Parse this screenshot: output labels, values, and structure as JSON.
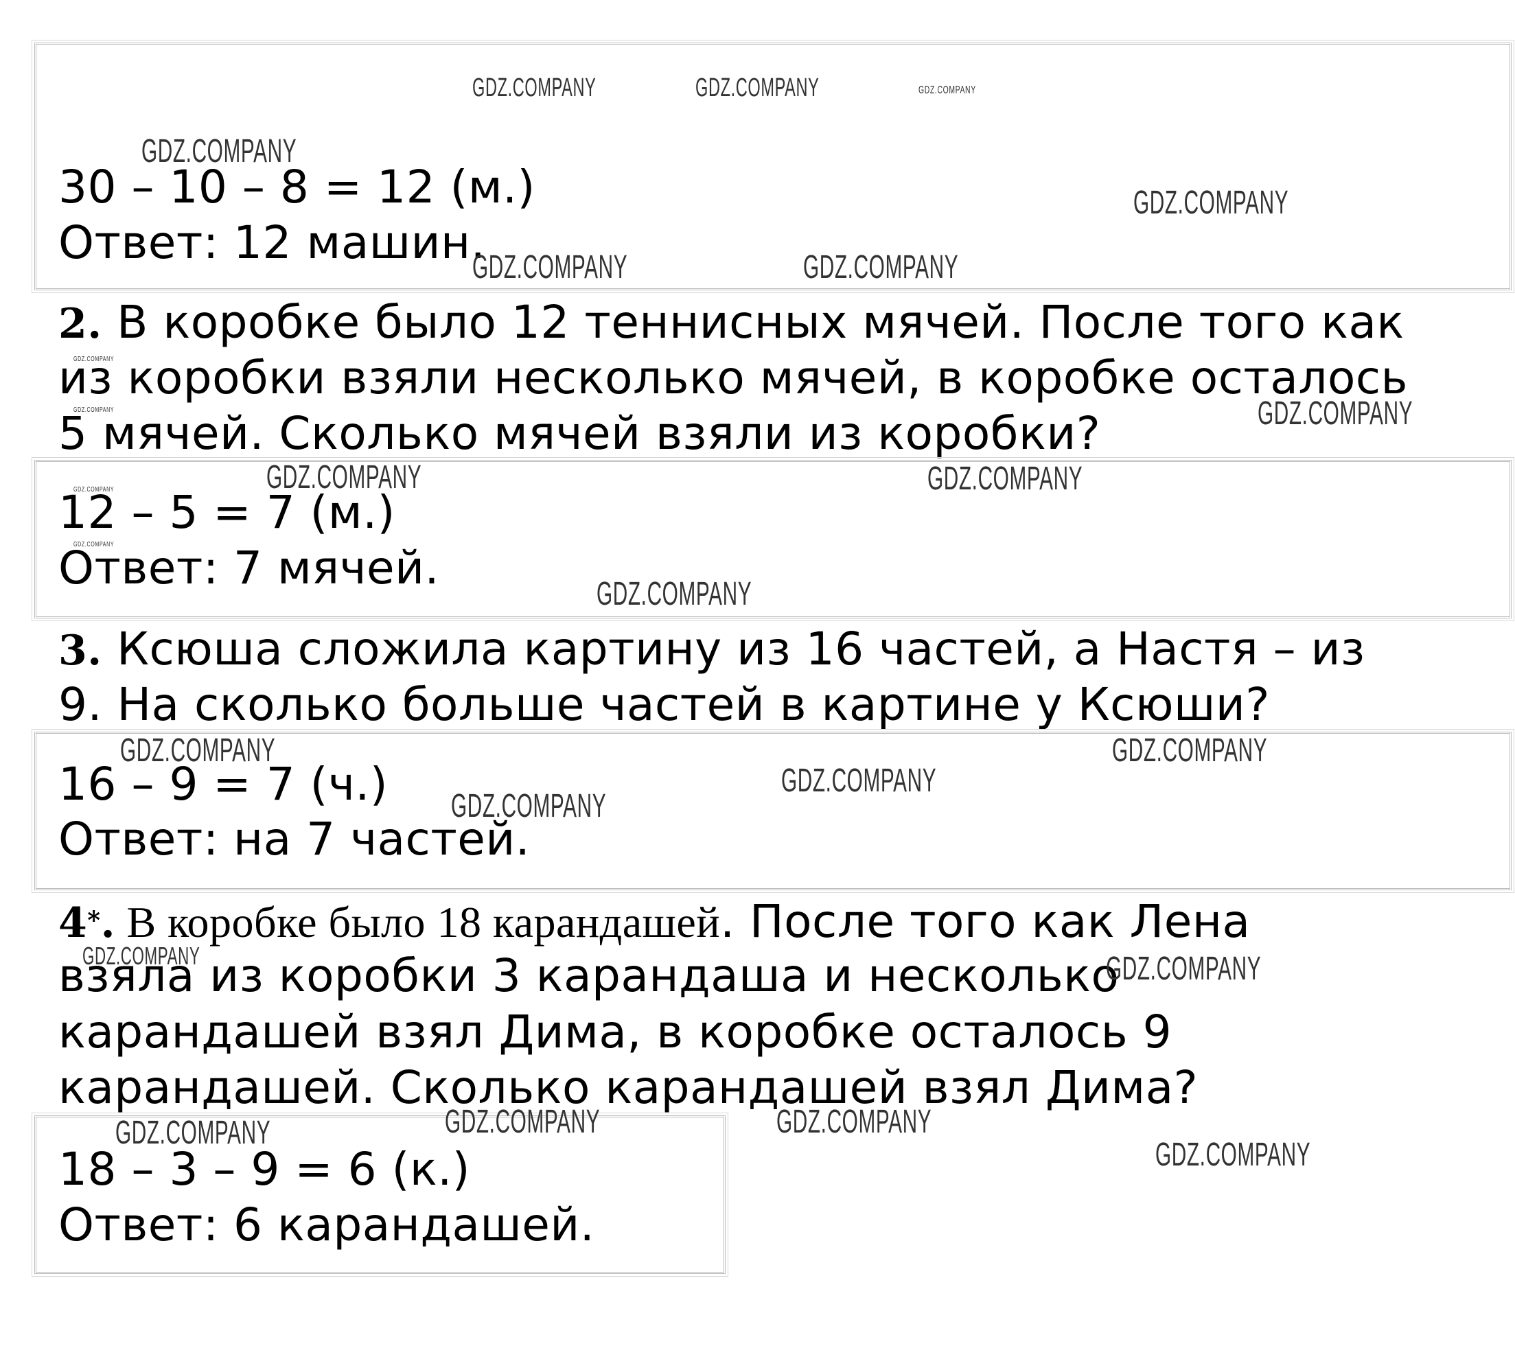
{
  "block1": {
    "solution": "30 – 10 – 8 = 12 (м.)",
    "answer": "Ответ: 12 машин."
  },
  "task2": {
    "number": "2.",
    "lines": [
      " В коробке было 12 теннисных мячей. После того как",
      "из коробки взяли несколько мячей, в коробке осталось",
      "5 мячей. Сколько мячей взяли из коробки?"
    ],
    "solution": "12 – 5 = 7 (м.)",
    "answer": "Ответ: 7 мячей."
  },
  "task3": {
    "number": "3.",
    "lines": [
      " Ксюша сложила картину из 16 частей, а Настя – из",
      "9. На сколько больше частей в картине у Ксюши?"
    ],
    "solution": "16 – 9 = 7 (ч.)",
    "answer": "Ответ: на 7 частей."
  },
  "task4": {
    "number": "4",
    "star": "*",
    "dot": ".",
    "serif_part": " В коробке было 18 карандашей",
    "line1_rest": ". После того как Лена",
    "lines": [
      "взяла из коробки 3 карандаша и несколько",
      "карандашей взял Дима, в коробке осталось 9",
      "карандашей. Сколько карандашей взял Дима?"
    ],
    "solution": "18 – 3 – 9 = 6 (к.)",
    "answer": "Ответ: 6 карандашей."
  },
  "watermark": "GDZ.COMPANY"
}
